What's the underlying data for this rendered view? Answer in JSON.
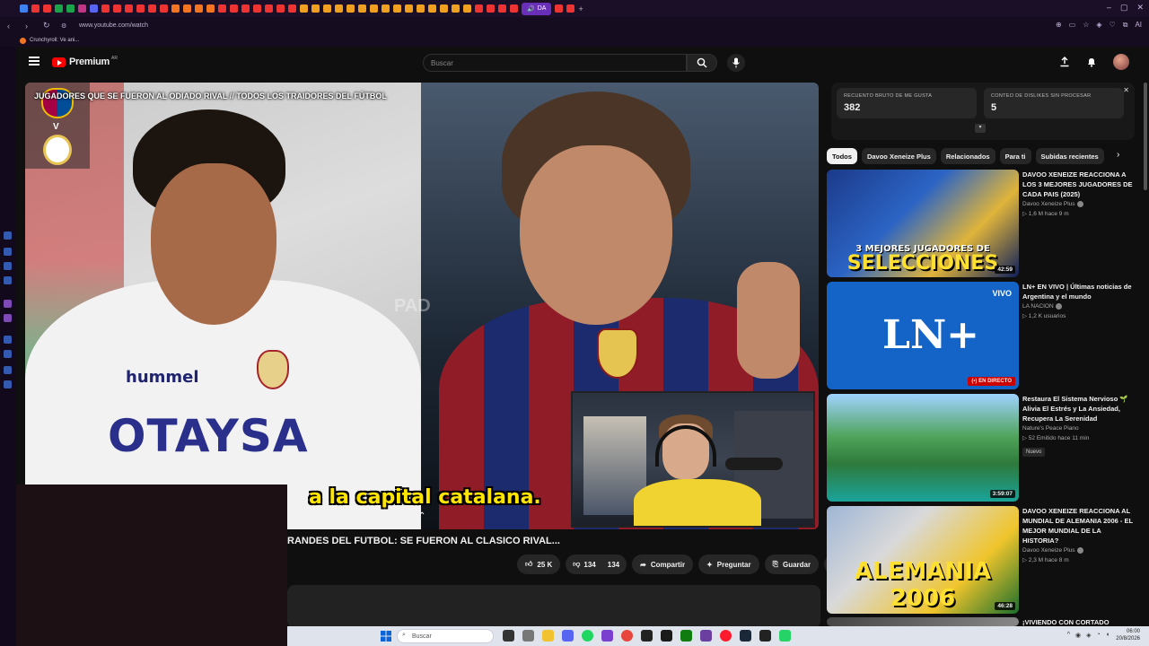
{
  "browser": {
    "url": "www.youtube.com/watch",
    "active_tab_label": "DA",
    "bookmark": "Crunchyroll: Ve ani...",
    "ai_label": "AI"
  },
  "header": {
    "logo_text": "Premium",
    "country": "AR",
    "search_placeholder": "Buscar"
  },
  "video": {
    "overlay_title": "JUGADORES QUE SE FUERON AL ODIADO RIVAL // TODOS LOS TRAIDORES DEL FÚTBOL",
    "subtitle": "a la capital catalana.",
    "brand_text": "hummel",
    "sponsor_text": "OTAYSA",
    "watermark": "PAD",
    "versus": "V"
  },
  "watch": {
    "title": "RANDES DEL FUTBOL: SE FUERON AL CLASICO RIVAL...",
    "likes": "25 K",
    "dislikes_a": "134",
    "dislikes_b": "134",
    "share_label": "Compartir",
    "ask_label": "Preguntar",
    "save_label": "Guardar"
  },
  "dislike_panel": {
    "likes_label": "RECUENTO BRUTO DE ME GUSTA",
    "likes_value": "382",
    "dislikes_label": "CONTEO DE DISLIKES SIN PROCESAR",
    "dislikes_value": "5"
  },
  "chips": [
    "Todos",
    "Davoo Xeneize Plus",
    "Relacionados",
    "Para ti",
    "Subidas recientes"
  ],
  "recommendations": [
    {
      "title": "DAVOO XENEIZE REACCIONA A LOS 3 MEJORES JUGADORES DE CADA PAIS (2025)",
      "channel": "Davoo Xeneize Plus",
      "meta": "▷ 1,6 M   hace 9 m",
      "duration": "42:59",
      "thumb_small": "3 MEJORES JUGADORES DE",
      "thumb_big": "SELECCIONES"
    },
    {
      "title": "LN+ EN VIVO | Últimas noticias de Argentina y el mundo",
      "channel": "LA NACION",
      "meta": "▷ 1,2 K usuarios",
      "live": "(•) EN DIRECTO",
      "thumb_logo": "LN+",
      "thumb_vivo": "VIVO"
    },
    {
      "title": "Restaura El Sistema Nervioso 🌱 Alivia El Estrés y La Ansiedad, Recupera La Serenidad",
      "channel": "Nature's Peace Piano",
      "meta": "▷ 52   Emitido hace 11 min",
      "badge": "Nuevo",
      "duration": "3:59:07"
    },
    {
      "title": "DAVOO XENEIZE REACCIONA AL MUNDIAL DE ALEMANIA 2006 - EL MEJOR MUNDIAL DE LA HISTORIA?",
      "channel": "Davoo Xeneize Plus",
      "meta": "▷ 2,3 M   hace 8 m",
      "duration": "46:28",
      "thumb_big": "ALEMANIA 2006"
    },
    {
      "title": "¡VIVIENDO CON CORTADO DOBLE"
    }
  ],
  "taskbar": {
    "search_placeholder": "Buscar",
    "time": "06:00",
    "date": "20/8/2026"
  },
  "colors": {
    "accent": "#ff0000",
    "tab_bar": "#1a0f26",
    "subtitle": "#ffe500"
  }
}
